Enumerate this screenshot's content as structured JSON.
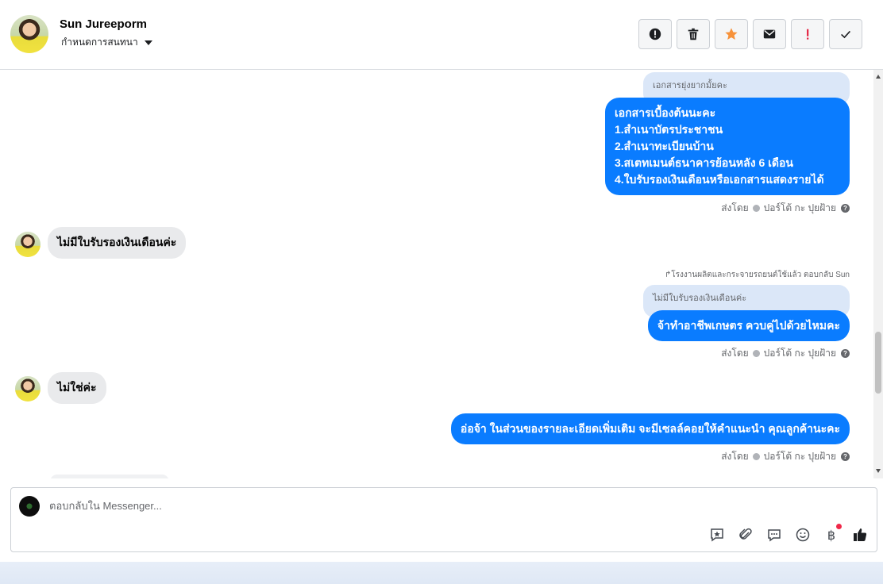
{
  "header": {
    "contact_name": "Sun Jureeporm",
    "assign_label": "กำหนดการสนทนา"
  },
  "toolbar": {
    "buttons": [
      "spam-report",
      "delete",
      "star",
      "mark-unread",
      "important",
      "done"
    ],
    "star_color": "#f7923a",
    "important_color": "#e41e3f"
  },
  "messages": {
    "m1_quote": "เอกสารยุ่งยากมั้ยคะ",
    "m1_lines": [
      "เอกสารเบื้องต้นนะคะ",
      "1.สำเนาบัตรประชาชน",
      "2.สำเนาทะเบียนบ้าน",
      "3.สเตทเมนต์ธนาคารย้อนหลัง 6 เดือน",
      "4.ใบรับรองเงินเดือนหรือเอกสารแสดงรายได้"
    ],
    "sent_by_label": "ส่งโดย",
    "sender_name": "ปอร์โต้ กะ ปุยฝ้าย",
    "m2_in": "ไม่มีใบรับรองเงินเดือนค่ะ",
    "m3_reply_note": "↱โรงงานผลิตและกระจายรถยนต์ใช้แล้ว ตอบกลับ Sun",
    "m3_quote": "ไม่มีใบรับรองเงินเดือนค่ะ",
    "m3_out": "จ้าทำอาชีพเกษตร ควบคู่ไปด้วยไหมคะ",
    "m4_in": "ไม่ใช่ค่ะ",
    "m5_out": "อ่อจ้า   ในส่วนของรายละเอียดเพิ่มเติม จะมีเซลล์คอยให้คำแนะนำ คุณลูกค้านะคะ"
  },
  "composer": {
    "placeholder": "ตอบกลับใน Messenger...",
    "value": "",
    "currency_symbol": "฿"
  },
  "colors": {
    "outgoing_bubble": "#0a7cff",
    "incoming_bubble": "#e9eaec",
    "quote_bubble": "#dbe7f8"
  }
}
